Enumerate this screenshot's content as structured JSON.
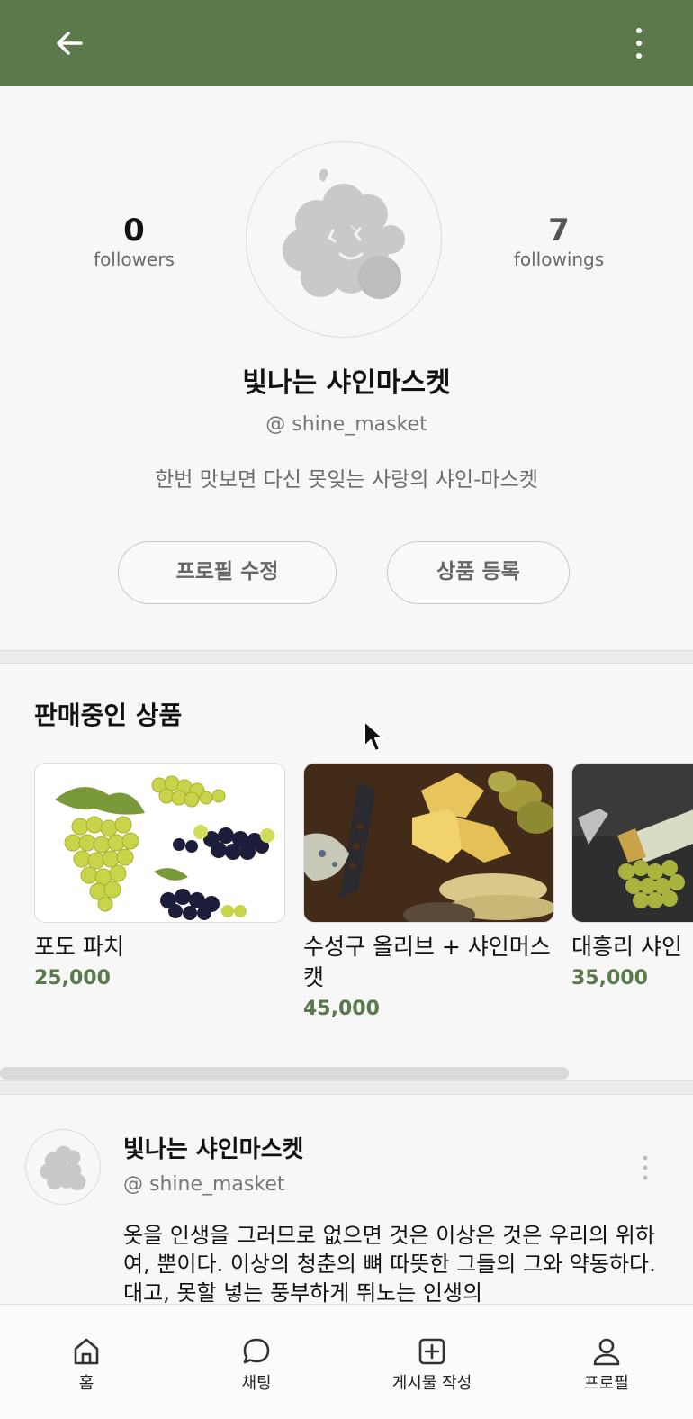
{
  "header": {
    "back_icon": "arrow-left-icon",
    "more_icon": "vertical-dots-icon"
  },
  "profile": {
    "followers_count": "0",
    "followers_label": "followers",
    "followings_count": "7",
    "followings_label": "followings",
    "name": "빛나는 샤인마스켓",
    "handle": "@ shine_masket",
    "intro": "한번 맛보면 다신 못잊는 사랑의 샤인-마스켓",
    "edit_button": "프로필 수정",
    "register_button": "상품 등록"
  },
  "products": {
    "title": "판매중인 상품",
    "items": [
      {
        "name": "포도 파치",
        "price": "25,000"
      },
      {
        "name": "수성구 올리브 + 샤인머스캣",
        "price": "45,000"
      },
      {
        "name": "대흥리 샤인",
        "price": "35,000"
      }
    ]
  },
  "post": {
    "author": "빛나는 샤인마스켓",
    "handle": "@ shine_masket",
    "text": "옷을 인생을 그러므로 없으면 것은 이상은 것은 우리의 위하여, 뿐이다. 이상의 청춘의 뼈 따뜻한 그들의 그와 약동하다. 대고, 못할 넣는 풍부하게 뛰노는 인생의"
  },
  "tabbar": {
    "items": [
      {
        "label": "홈",
        "icon": "home-icon"
      },
      {
        "label": "채팅",
        "icon": "chat-bubble-icon"
      },
      {
        "label": "게시물 작성",
        "icon": "plus-square-icon"
      },
      {
        "label": "프로필",
        "icon": "user-icon"
      }
    ]
  },
  "colors": {
    "brand": "#5a7a4c",
    "price": "#5a7a4c"
  }
}
